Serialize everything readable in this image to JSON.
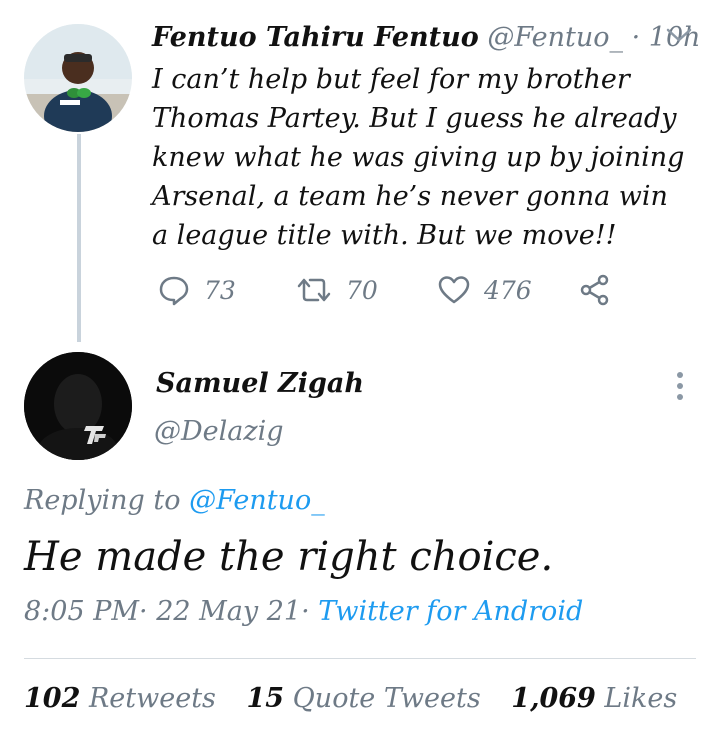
{
  "original_tweet": {
    "display_name": "Fentuo Tahiru Fentuo",
    "handle": "@Fentuo_",
    "separator": "·",
    "time": "10h",
    "text": "I can’t help but feel for my brother Thomas Partey. But I guess he already knew what he was giving up by joining Arsenal, a team he’s never gonna win a league title with. But we move!!",
    "reply_count": "73",
    "retweet_count": "70",
    "like_count": "476"
  },
  "reply_tweet": {
    "display_name": "Samuel Zigah",
    "handle": "@Delazig",
    "replying_to_label": "Replying to",
    "replying_to_handle": "@Fentuo_",
    "text": "He made the right choice.",
    "time": "8:05 PM",
    "date": "22 May 21",
    "separator": "·",
    "source": "Twitter for Android"
  },
  "stats": {
    "retweets_count": "102",
    "retweets_label": "Retweets",
    "quote_count": "15",
    "quote_label": "Quote Tweets",
    "likes_count": "1,069",
    "likes_label": "Likes"
  },
  "colors": {
    "link": "#1d9bf0",
    "muted": "#6e7a86",
    "thread_line": "#c9d3dc"
  },
  "icons": [
    "reply-icon",
    "retweet-icon",
    "like-icon",
    "share-icon",
    "chevron-down-icon",
    "more-vertical-icon"
  ]
}
